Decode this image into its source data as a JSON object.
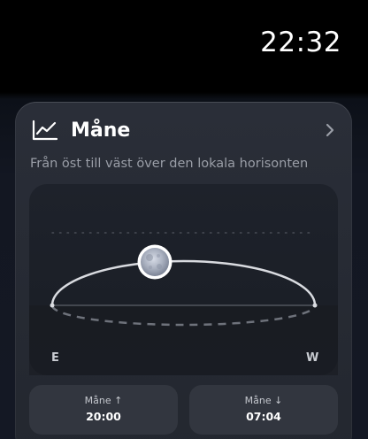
{
  "status_bar": {
    "time": "22:32"
  },
  "card": {
    "icon": "line-chart-icon",
    "title": "Måne",
    "chevron_icon": "chevron-right-icon",
    "subtitle": "Från öst till väst över den lokala horisonten",
    "arc": {
      "east_label": "E",
      "west_label": "W",
      "moon_icon": "moon-icon",
      "moon_progress_fraction": 0.4
    },
    "moonrise": {
      "label": "Måne ↑",
      "value": "20:00"
    },
    "moonset": {
      "label": "Måne ↓",
      "value": "07:04"
    }
  },
  "colors": {
    "background": "#000000",
    "card": "#2a2e38",
    "panel": "#1e222b",
    "info_box": "#32363f",
    "arc": "#d9dbe0",
    "subtitle": "#9a9ea7"
  }
}
